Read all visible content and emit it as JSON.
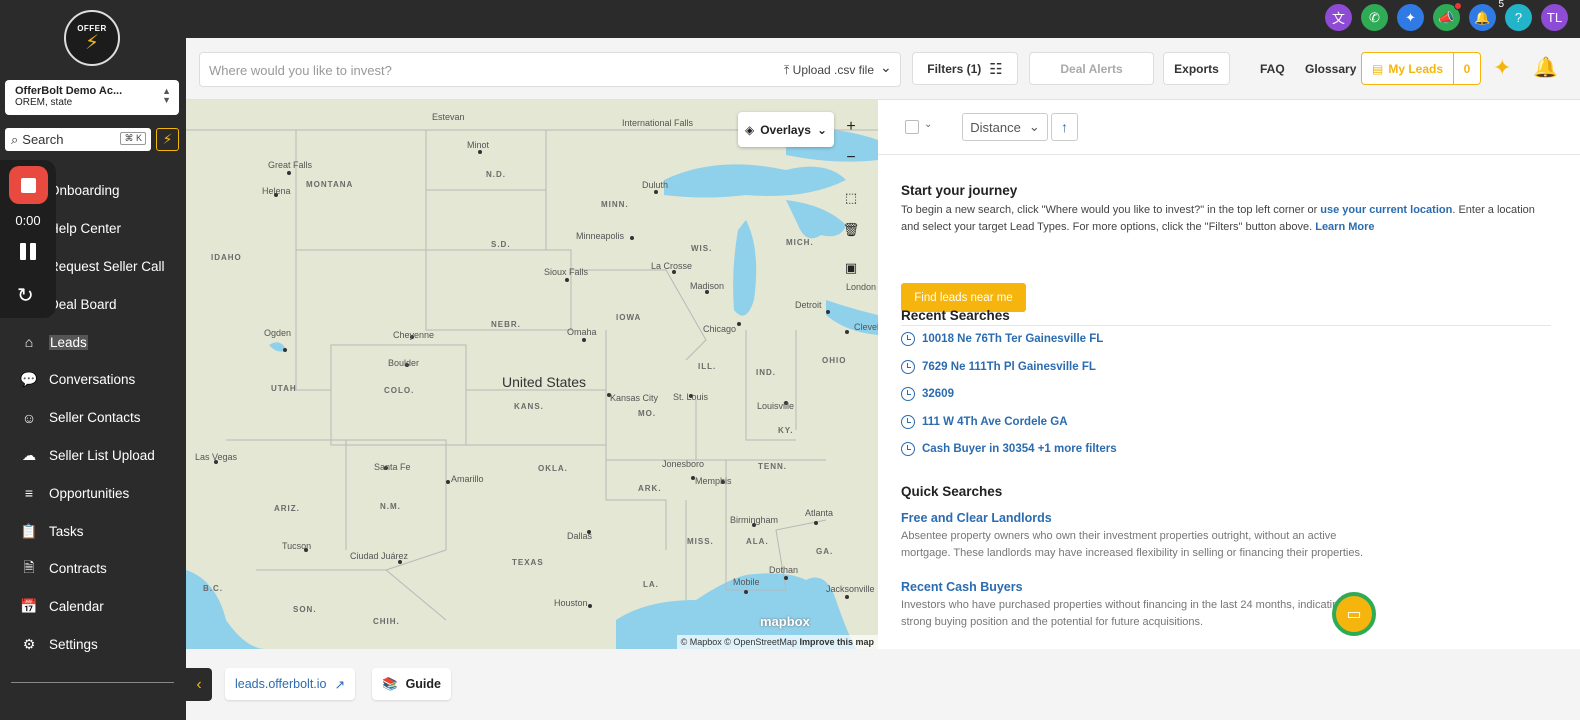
{
  "colors": {
    "accent": "#f5b50d",
    "link": "#2b6cb0",
    "sidebar": "#2b2b2b",
    "record": "#e84a3f"
  },
  "top_icons": [
    {
      "name": "translate-icon",
      "glyph": "文",
      "color": "#8e4bd6"
    },
    {
      "name": "phone-icon",
      "glyph": "✆",
      "color": "#2faa55"
    },
    {
      "name": "ai-sparkle-icon",
      "glyph": "✦",
      "color": "#2f7ae5"
    },
    {
      "name": "megaphone-icon",
      "glyph": "📣",
      "color": "#2faa55"
    },
    {
      "name": "notification-bell-icon",
      "glyph": "🔔",
      "color": "#2f7ae5",
      "count": "5"
    },
    {
      "name": "help-icon",
      "glyph": "?",
      "color": "#22b5c9"
    },
    {
      "name": "user-avatar",
      "glyph": "TL",
      "color": "#8e4bd6"
    }
  ],
  "sidebar": {
    "logo_text": "OFFER\nBOLT",
    "account": {
      "name": "OfferBolt Demo Ac...",
      "location": "OREM, state"
    },
    "search": {
      "label": "Search",
      "shortcut": "⌘ K"
    },
    "items": [
      {
        "label": "Onboarding",
        "icon": "onboarding-icon",
        "glyph": "◎"
      },
      {
        "label": "Help Center",
        "icon": "help-center-icon",
        "glyph": "?"
      },
      {
        "label": "Request Seller Call",
        "icon": "seller-call-icon",
        "glyph": "✆"
      },
      {
        "label": "Deal Board",
        "icon": "deal-board-icon",
        "glyph": "▦"
      },
      {
        "label": "Leads",
        "icon": "home-icon",
        "glyph": "⌂",
        "active": true
      },
      {
        "label": "Conversations",
        "icon": "chat-bubble-icon",
        "glyph": "💬"
      },
      {
        "label": "Seller Contacts",
        "icon": "contacts-icon",
        "glyph": "☺"
      },
      {
        "label": "Seller List Upload",
        "icon": "cloud-upload-icon",
        "glyph": "☁"
      },
      {
        "label": "Opportunities",
        "icon": "list-icon",
        "glyph": "≡"
      },
      {
        "label": "Tasks",
        "icon": "clipboard-icon",
        "glyph": "📋"
      },
      {
        "label": "Contracts",
        "icon": "document-icon",
        "glyph": "🗎"
      },
      {
        "label": "Calendar",
        "icon": "calendar-icon",
        "glyph": "📅"
      },
      {
        "label": "Settings",
        "icon": "gear-icon",
        "glyph": "⚙"
      }
    ]
  },
  "recorder": {
    "time": "0:00"
  },
  "toolbar": {
    "search_placeholder": "Where would you like to invest?",
    "upload_label": "Upload .csv file",
    "filters_label": "Filters (1)",
    "deal_alerts_label": "Deal Alerts",
    "exports_label": "Exports",
    "faq_label": "FAQ",
    "glossary_label": "Glossary",
    "my_leads_label": "My Leads",
    "my_leads_count": "0"
  },
  "map": {
    "overlays_label": "Overlays",
    "country": "United States",
    "states": [
      "MONTANA",
      "N.D.",
      "MINN.",
      "S.D.",
      "WIS.",
      "MICH.",
      "IDAHO",
      "NEBR.",
      "IOWA",
      "UTAH",
      "COLO.",
      "KANS.",
      "MO.",
      "ILL.",
      "IND.",
      "OHIO",
      "KY.",
      "TENN.",
      "OKLA.",
      "ARK.",
      "ARIZ.",
      "N.M.",
      "TEXAS",
      "MISS.",
      "ALA.",
      "GA.",
      "LA.",
      "SON.",
      "CHIH.",
      "B.C."
    ],
    "cities": [
      "Estevan",
      "International Falls",
      "Minot",
      "Great Falls",
      "Helena",
      "Duluth",
      "Minneapolis",
      "Sioux Falls",
      "La Crosse",
      "Madison",
      "Detroit",
      "London",
      "Cleveland",
      "Ogden",
      "Cheyenne",
      "Omaha",
      "Chicago",
      "Boulder",
      "Kansas City",
      "St. Louis",
      "Louisville",
      "Las Vegas",
      "Santa Fe",
      "Amarillo",
      "Jonesboro",
      "Memphis",
      "Birmingham",
      "Atlanta",
      "Tucson",
      "Ciudad Juárez",
      "Dallas",
      "Dothan",
      "Houston",
      "Mobile",
      "Jacksonville"
    ],
    "brand": "mapbox",
    "attribution": "© Mapbox © OpenStreetMap",
    "improve": "Improve this map"
  },
  "panel": {
    "sort_label": "Distance",
    "journey_title": "Start your journey",
    "journey_text_1": "To begin a new search, click \"Where would you like to invest?\" in the top left corner or ",
    "journey_link_1": "use your current location",
    "journey_text_2": ". Enter a location and select your target Lead Types. For more options, click the \"Filters\" button above. ",
    "journey_link_2": "Learn More",
    "find_button": "Find leads near me",
    "recent_title": "Recent Searches",
    "recent": [
      "10018 Ne 76Th Ter Gainesville FL",
      "7629 Ne 111Th Pl Gainesville FL",
      "32609",
      "111 W 4Th Ave Cordele GA",
      "Cash Buyer in 30354 +1 more filters"
    ],
    "quick_title": "Quick Searches",
    "quick": [
      {
        "title": "Free and Clear Landlords",
        "desc": "Absentee property owners who own their investment properties outright, without an active mortgage. These landlords may have increased flexibility in selling or financing their properties."
      },
      {
        "title": "Recent Cash Buyers",
        "desc": "Investors who have purchased properties without financing in the last 24 months, indicating a strong buying position and the potential for future acquisitions."
      }
    ]
  },
  "bottom": {
    "site_link": "leads.offerbolt.io",
    "guide_label": "Guide"
  }
}
